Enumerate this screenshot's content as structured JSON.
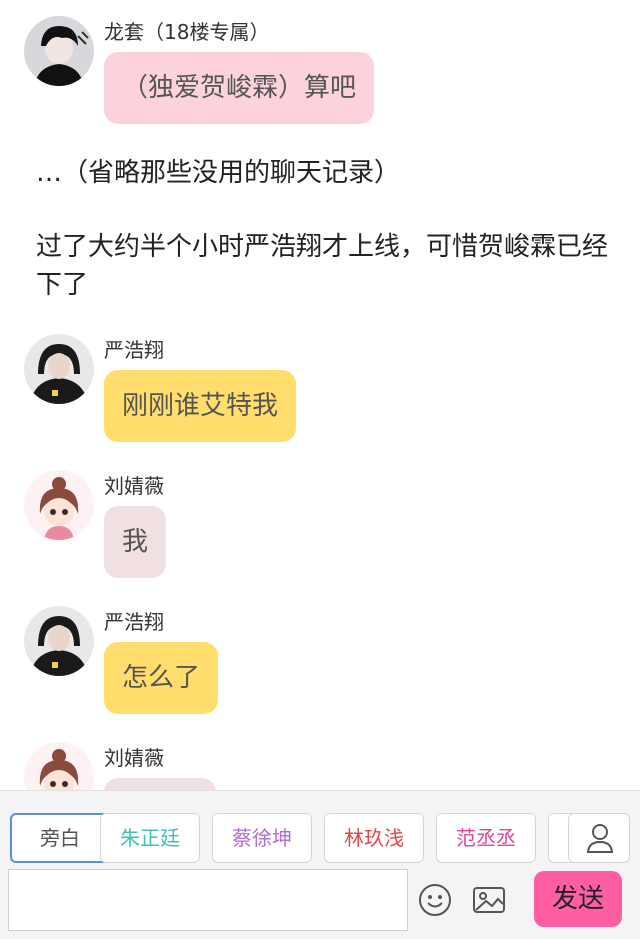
{
  "messages": [
    {
      "sender": "龙套（18楼专属）",
      "text": "（独爱贺峻霖）算吧",
      "bubble_color": "#fcd2dc"
    },
    {
      "sender": "严浩翔",
      "text": "刚刚谁艾特我",
      "bubble_color": "#ffde6e"
    },
    {
      "sender": "刘婧薇",
      "text": "我",
      "bubble_color": "#f1e0e2"
    },
    {
      "sender": "严浩翔",
      "text": "怎么了",
      "bubble_color": "#ffde6e"
    },
    {
      "sender": "刘婧薇",
      "text": "",
      "bubble_color": "#f1e0e2"
    }
  ],
  "narration": [
    "…（省略那些没用的聊天记录）",
    "过了大约半个小时严浩翔才上线，可惜贺峻霖已经下了"
  ],
  "characters": [
    {
      "label": "旁白",
      "color": "#555555"
    },
    {
      "label": "朱正廷",
      "color": "#3cc3b3"
    },
    {
      "label": "蔡徐坤",
      "color": "#b06fd0"
    },
    {
      "label": "林玖浅",
      "color": "#e24848"
    },
    {
      "label": "范丞丞",
      "color": "#e0449a"
    }
  ],
  "input": {
    "placeholder": ""
  },
  "send_label": "发送",
  "icons": {
    "profile": "person-icon",
    "emoji": "smiley-icon",
    "image": "image-icon"
  }
}
